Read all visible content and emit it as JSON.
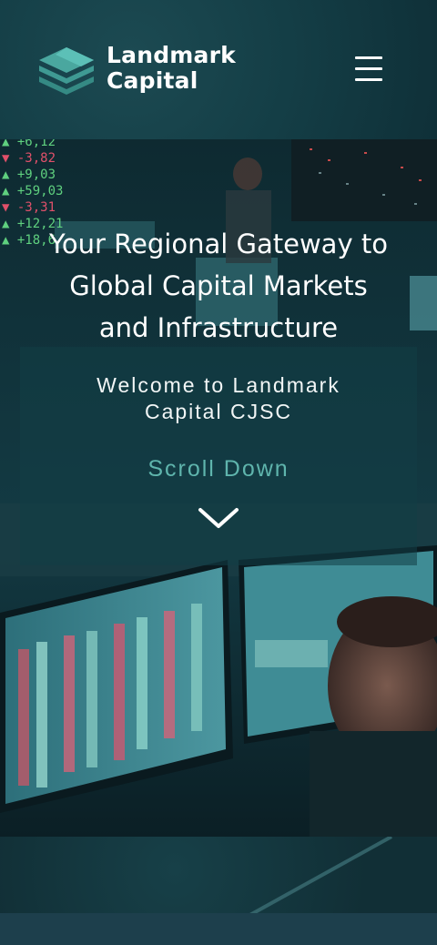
{
  "brand": {
    "name_line1": "Landmark",
    "name_line2": "Capital",
    "accent": "#5fb5ad"
  },
  "header": {
    "menu_icon": "hamburger-menu-icon"
  },
  "hero": {
    "ticker": [
      {
        "dir": "up",
        "value": "+6,12"
      },
      {
        "dir": "down",
        "value": "-3,82"
      },
      {
        "dir": "up",
        "value": "+9,03"
      },
      {
        "dir": "up",
        "value": "+59,03"
      },
      {
        "dir": "down",
        "value": "-3,31"
      },
      {
        "dir": "up",
        "value": "+12,21"
      },
      {
        "dir": "up",
        "value": "+18,6"
      }
    ],
    "headline_line1": "Your Regional Gateway to",
    "headline_line2": "Global Capital Markets",
    "headline_line3": "and Infrastructure",
    "welcome_line1": "Welcome to Landmark",
    "welcome_line2": "Capital CJSC",
    "scroll_label": "Scroll Down",
    "scroll_icon": "chevron-down-icon"
  }
}
